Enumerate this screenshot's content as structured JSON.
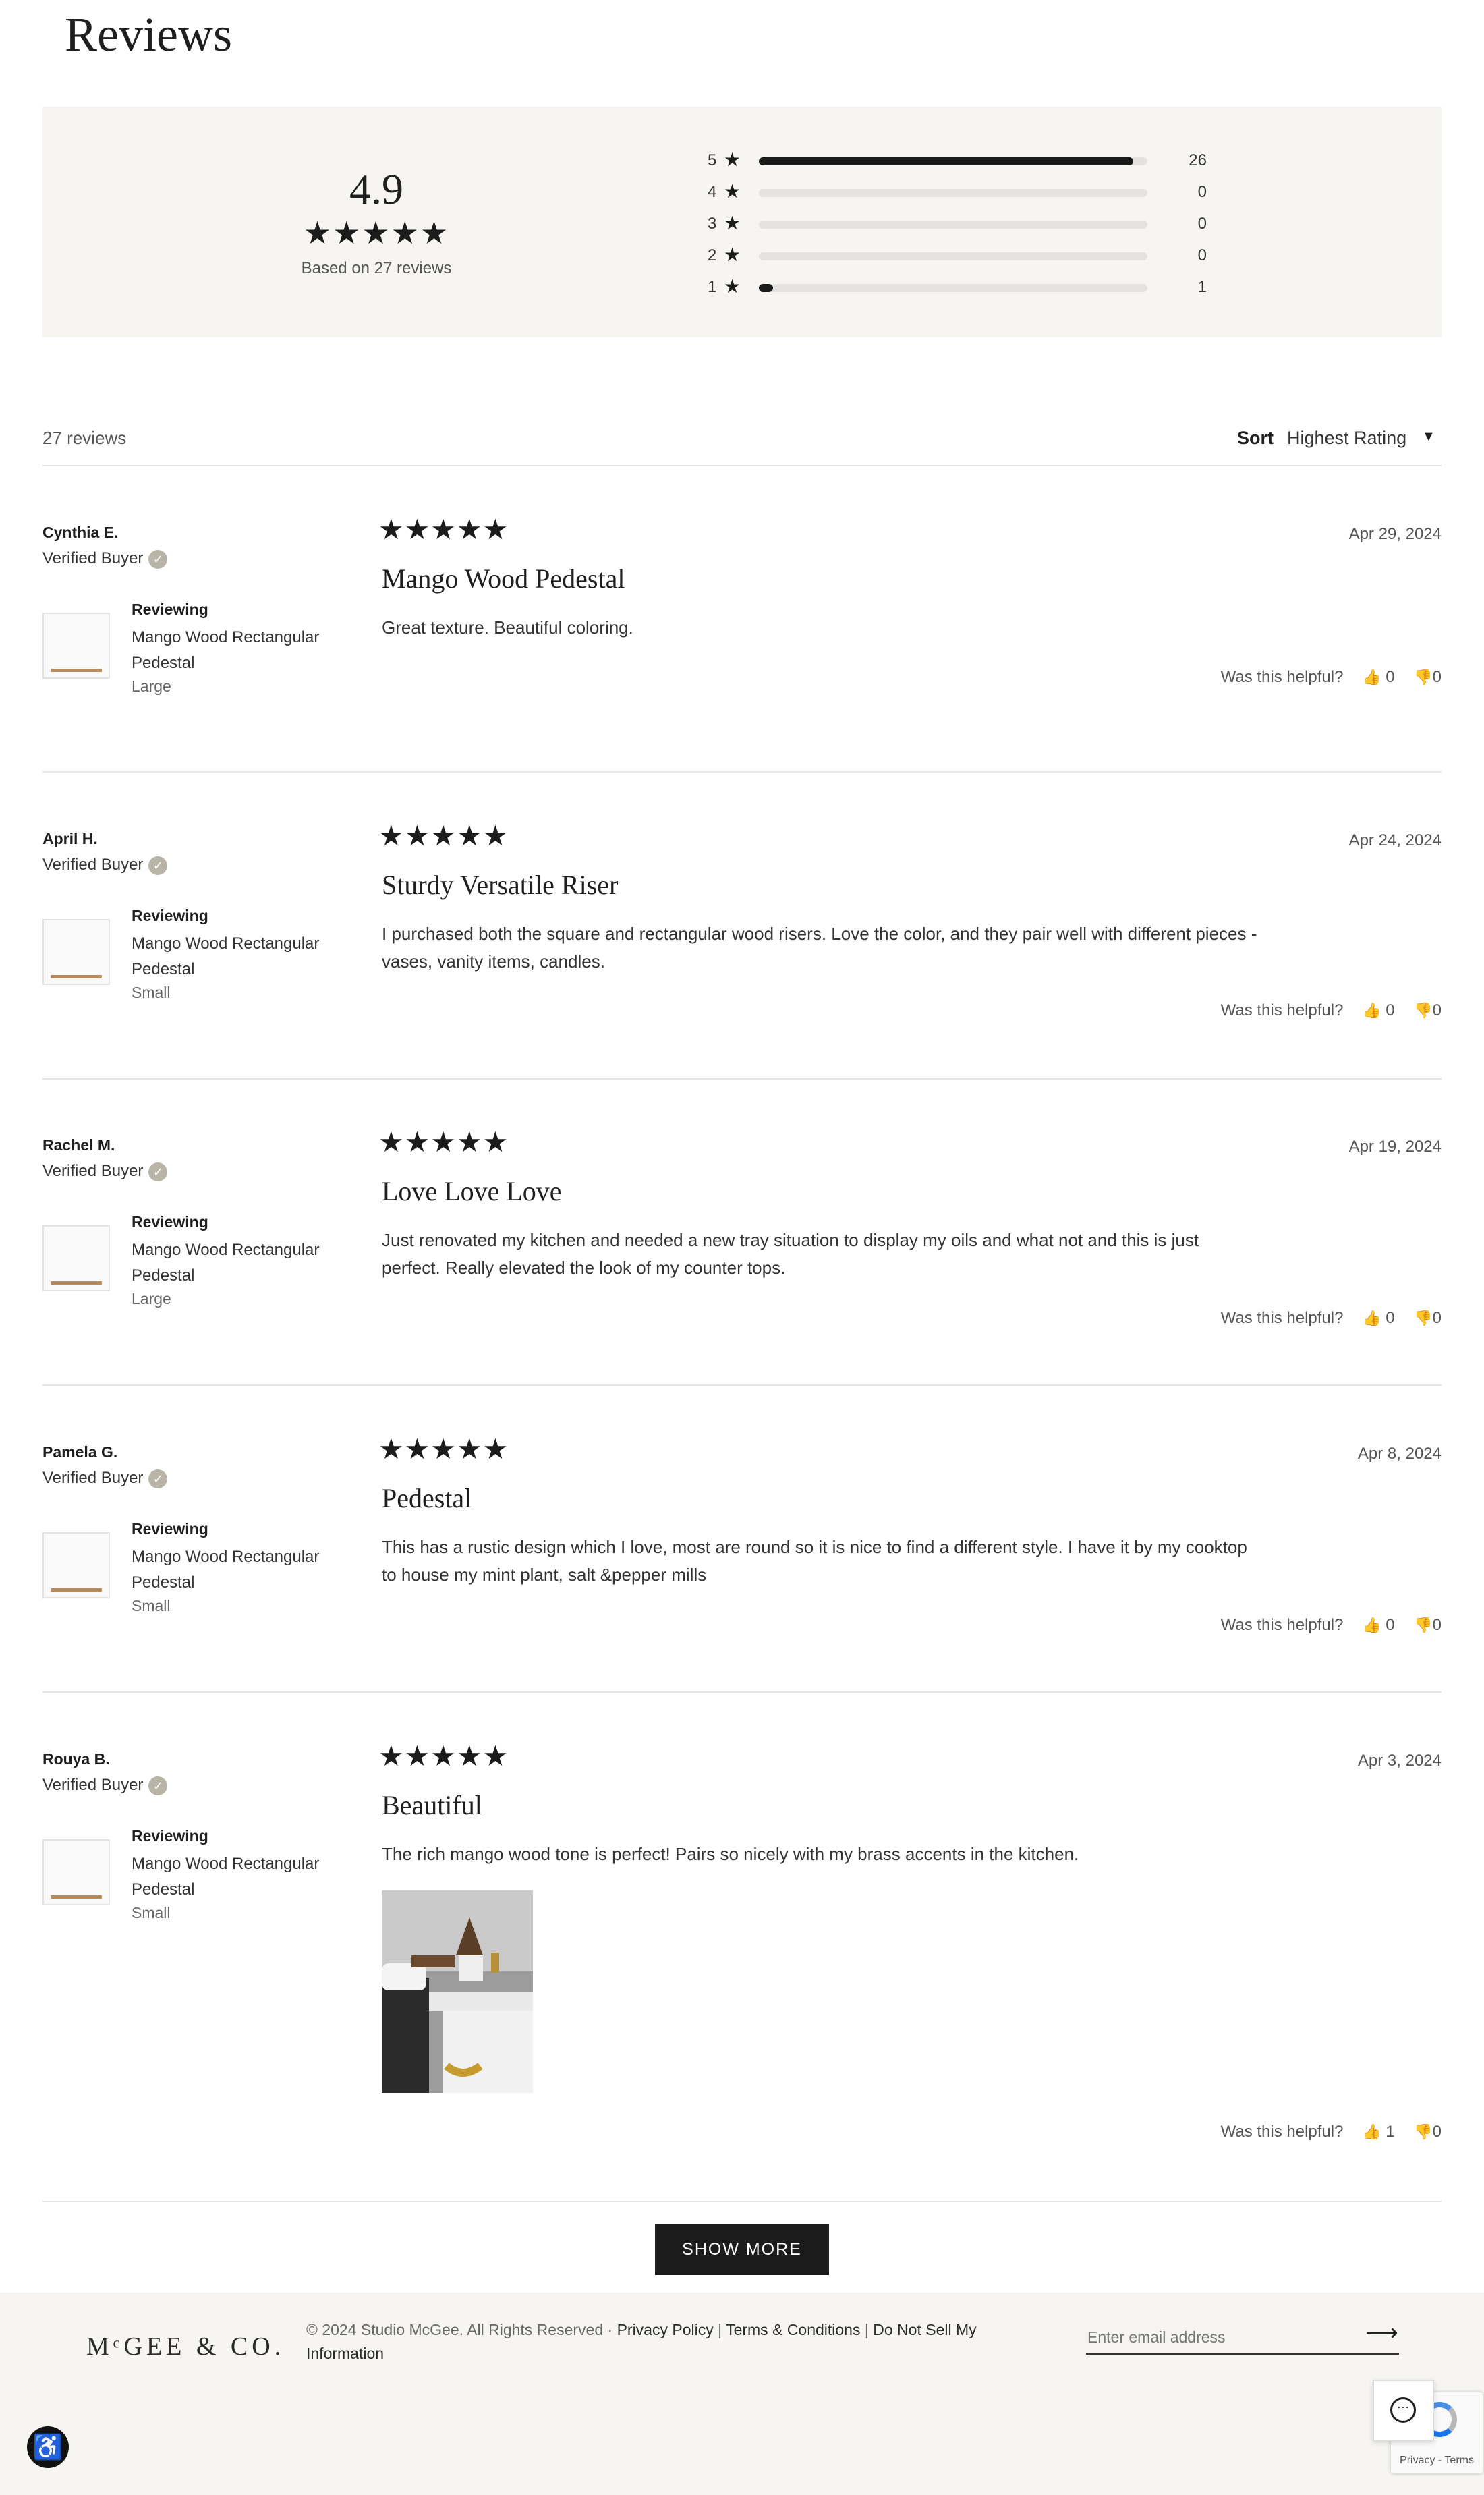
{
  "page_title": "Reviews",
  "summary": {
    "average": "4.9",
    "stars": "★★★★★",
    "based_on": "Based on 27 reviews",
    "distribution": [
      {
        "stars": "5",
        "count": "26",
        "fraction": 0.963
      },
      {
        "stars": "4",
        "count": "0",
        "fraction": 0
      },
      {
        "stars": "3",
        "count": "0",
        "fraction": 0
      },
      {
        "stars": "2",
        "count": "0",
        "fraction": 0
      },
      {
        "stars": "1",
        "count": "1",
        "fraction": 0.037
      }
    ]
  },
  "toolbar": {
    "count": "27 reviews",
    "sort_label": "Sort",
    "sort_value": "Highest Rating"
  },
  "reviews": [
    {
      "name": "Cynthia E.",
      "verified": "Verified Buyer",
      "reviewing_label": "Reviewing",
      "product": "Mango Wood Rectangular Pedestal",
      "variant": "Large",
      "stars": "★★★★★",
      "date": "Apr 29, 2024",
      "title": "Mango Wood Pedestal",
      "body": "Great texture. Beautiful coloring.",
      "helpful_label": "Was this helpful?",
      "up": "0",
      "down": "0"
    },
    {
      "name": "April H.",
      "verified": "Verified Buyer",
      "reviewing_label": "Reviewing",
      "product": "Mango Wood Rectangular Pedestal",
      "variant": "Small",
      "stars": "★★★★★",
      "date": "Apr 24, 2024",
      "title": "Sturdy Versatile Riser",
      "body": "I purchased both the square and rectangular wood risers. Love the color, and they pair well with different pieces - vases, vanity items, candles.",
      "helpful_label": "Was this helpful?",
      "up": "0",
      "down": "0"
    },
    {
      "name": "Rachel M.",
      "verified": "Verified Buyer",
      "reviewing_label": "Reviewing",
      "product": "Mango Wood Rectangular Pedestal",
      "variant": "Large",
      "stars": "★★★★★",
      "date": "Apr 19, 2024",
      "title": "Love Love Love",
      "body": "Just renovated my kitchen and needed a new tray situation to display my oils and what not and this is just perfect. Really elevated the look of my counter tops.",
      "helpful_label": "Was this helpful?",
      "up": "0",
      "down": "0"
    },
    {
      "name": "Pamela G.",
      "verified": "Verified Buyer",
      "reviewing_label": "Reviewing",
      "product": "Mango Wood Rectangular Pedestal",
      "variant": "Small",
      "stars": "★★★★★",
      "date": "Apr 8, 2024",
      "title": "Pedestal",
      "body": "This has a rustic design which I love, most are round so it is nice to find a different style. I have it by my cooktop to house my mint plant, salt &pepper mills",
      "helpful_label": "Was this helpful?",
      "up": "0",
      "down": "0"
    },
    {
      "name": "Rouya B.",
      "verified": "Verified Buyer",
      "reviewing_label": "Reviewing",
      "product": "Mango Wood Rectangular Pedestal",
      "variant": "Small",
      "stars": "★★★★★",
      "date": "Apr 3, 2024",
      "title": "Beautiful",
      "body": "The rich mango wood tone is perfect! Pairs so nicely with my brass accents in the kitchen.",
      "helpful_label": "Was this helpful?",
      "up": "1",
      "down": "0"
    }
  ],
  "show_more": "SHOW MORE",
  "footer": {
    "logo": "MᶜGEE & CO.",
    "copyright": "© 2024 Studio McGee. All Rights Reserved ·",
    "privacy": "Privacy Policy",
    "terms": "Terms & Conditions",
    "do_not_sell": "Do Not Sell My Information",
    "email_placeholder": "Enter email address",
    "recaptcha": "Privacy - Terms"
  },
  "colors": {
    "accent": "#1c1c1c",
    "summary_bg": "#f6f5f1",
    "verified_badge": "#b9b5a6"
  },
  "icons": [
    "star-icon",
    "check-icon",
    "thumbs-up-icon",
    "thumbs-down-icon",
    "arrow-right-icon",
    "chat-icon",
    "accessibility-icon",
    "chevron-down-icon"
  ]
}
